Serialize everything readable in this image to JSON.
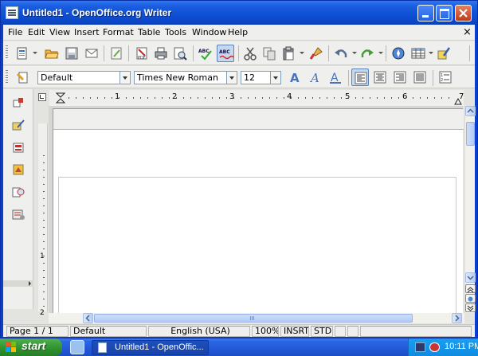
{
  "window": {
    "title": "Untitled1 - OpenOffice.org Writer",
    "close_doc_glyph": "×"
  },
  "menubar": [
    {
      "label": "File",
      "u": "F",
      "rest": "ile"
    },
    {
      "label": "Edit",
      "u": "E",
      "rest": "dit"
    },
    {
      "label": "View",
      "u": "V",
      "rest": "iew"
    },
    {
      "label": "Insert",
      "u": "I",
      "rest": "nsert"
    },
    {
      "label": "Format",
      "u": "F",
      "rest": "o",
      "pre": "F",
      "full": "Format"
    },
    {
      "label": "Table",
      "u": "a",
      "pre": "T",
      "rest": "ble"
    },
    {
      "label": "Tools",
      "u": "T",
      "rest": "ools"
    },
    {
      "label": "Window",
      "u": "W",
      "rest": "indow"
    },
    {
      "label": "Help",
      "u": "H",
      "rest": "elp"
    }
  ],
  "formatting": {
    "paragraph_style": "Default",
    "font_name": "Times New Roman",
    "font_size": "12"
  },
  "ruler": {
    "numbers": [
      "1",
      "2",
      "3",
      "4",
      "5",
      "6",
      "7"
    ],
    "vertical_numbers": [
      "1",
      "2"
    ]
  },
  "statusbar": {
    "page": "Page 1 / 1",
    "style": "Default",
    "language": "English (USA)",
    "zoom": "100%",
    "insert_mode": "INSRT",
    "selection_mode": "STD"
  },
  "taskbar": {
    "start_label": "start",
    "task_label": "Untitled1 - OpenOffic...",
    "clock": "10:11 PM"
  },
  "icons": {
    "toolbar1": [
      "new-document-icon",
      "open-icon",
      "save-icon",
      "email-icon",
      "edit-file-icon",
      "export-pdf-icon",
      "print-icon",
      "print-preview-icon",
      "spellcheck-icon",
      "autospellcheck-icon",
      "cut-icon",
      "copy-icon",
      "paste-icon",
      "format-paintbrush-icon",
      "undo-icon",
      "redo-icon",
      "navigator-icon",
      "table-icon",
      "show-draw-functions-icon"
    ],
    "toolbar2": [
      "styles-and-formatting-icon",
      "bold-icon",
      "italic-icon",
      "underline-icon",
      "align-left-icon",
      "align-center-icon",
      "align-right-icon",
      "justify-icon",
      "numbering-icon"
    ]
  }
}
